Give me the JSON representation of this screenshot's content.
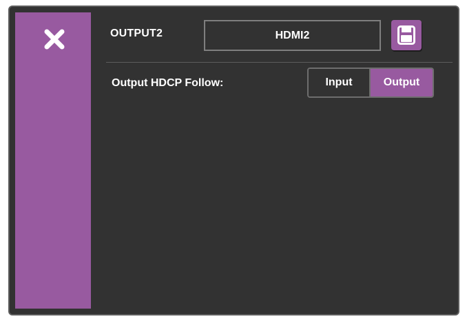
{
  "panel": {
    "port_label": "OUTPUT2",
    "port_name_value": "HDMI2"
  },
  "icons": {
    "close": "close-icon",
    "save": "save-icon"
  },
  "settings": {
    "hdcp_follow_label": "Output HDCP Follow:",
    "options": [
      "Input",
      "Output"
    ],
    "selected": "Output"
  },
  "colors": {
    "accent": "#985aa0",
    "background": "#323232",
    "border": "#5d5d5d",
    "text": "#ffffff"
  }
}
